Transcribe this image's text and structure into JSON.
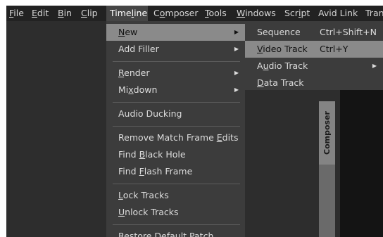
{
  "menubar": {
    "items": [
      {
        "name": "file",
        "label": "File",
        "u": "F",
        "rest": "ile"
      },
      {
        "name": "edit",
        "label": "Edit",
        "u": "E",
        "rest": "dit"
      },
      {
        "name": "bin",
        "label": "Bin",
        "u": "B",
        "rest": "in"
      },
      {
        "name": "clip",
        "label": "Clip",
        "u": "C",
        "rest": "lip"
      },
      {
        "name": "timeline",
        "label": "Timeline",
        "pre": "Time",
        "u": "l",
        "rest": "ine"
      },
      {
        "name": "composer",
        "label": "Composer",
        "pre": "C",
        "u": "o",
        "rest": "mposer"
      },
      {
        "name": "tools",
        "label": "Tools",
        "u": "T",
        "rest": "ools"
      },
      {
        "name": "windows",
        "label": "Windows",
        "u": "W",
        "rest": "indows"
      },
      {
        "name": "script",
        "label": "Script",
        "pre": "Scr",
        "u": "i",
        "rest": "pt"
      },
      {
        "name": "avid-link",
        "label": "Avid Link"
      },
      {
        "name": "tran",
        "label": "Tran"
      }
    ]
  },
  "timeline_menu": {
    "new": {
      "u": "N",
      "rest": "ew"
    },
    "add_filler": "Add Filler",
    "render": {
      "u": "R",
      "rest": "ender"
    },
    "mixdown": {
      "pre": "Mi",
      "u": "x",
      "rest": "down"
    },
    "audio_ducking": "Audio Ducking",
    "remove_match": {
      "pre": "Remove Match Frame ",
      "u": "E",
      "rest": "dits"
    },
    "find_black": {
      "pre": "Find ",
      "u": "B",
      "rest": "lack Hole"
    },
    "find_flash": {
      "pre": "Find ",
      "u": "F",
      "rest": "lash Frame"
    },
    "lock_tracks": {
      "u": "L",
      "rest": "ock Tracks"
    },
    "unlock_tracks": {
      "u": "U",
      "rest": "nlock Tracks"
    },
    "restore_patch": "Restore Default Patch"
  },
  "new_submenu": {
    "sequence": {
      "label": "Sequence",
      "shortcut": "Ctrl+Shift+N"
    },
    "video_track": {
      "u": "V",
      "rest": "ideo Track",
      "shortcut": "Ctrl+Y"
    },
    "audio_track": {
      "pre": "A",
      "u": "u",
      "rest": "dio Track"
    },
    "data_track": {
      "u": "D",
      "rest": "ata Track"
    }
  },
  "composer_tab": {
    "label": "Composer"
  },
  "icons": {
    "submenu_arrow": "▶"
  }
}
